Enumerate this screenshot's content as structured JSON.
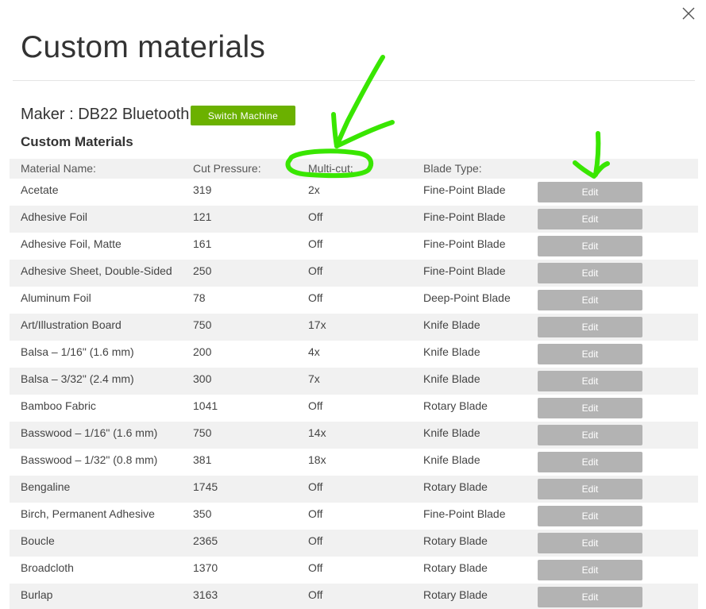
{
  "dialog": {
    "title": "Custom materials",
    "close_icon": "close-icon"
  },
  "machine": {
    "label": "Maker : DB22 Bluetooth",
    "switch_button": "Switch Machine",
    "switch_button_color": "#6bb100"
  },
  "materials": {
    "section_title": "Custom Materials",
    "columns": {
      "name": "Material Name:",
      "pressure": "Cut Pressure:",
      "multicut": "Multi-cut:",
      "blade": "Blade Type:"
    },
    "edit_label": "Edit",
    "edit_button_color": "#b3b3b3",
    "rows": [
      {
        "name": "Acetate",
        "pressure": "319",
        "multicut": "2x",
        "blade": "Fine-Point Blade"
      },
      {
        "name": "Adhesive Foil",
        "pressure": "121",
        "multicut": "Off",
        "blade": "Fine-Point Blade"
      },
      {
        "name": "Adhesive Foil, Matte",
        "pressure": "161",
        "multicut": "Off",
        "blade": "Fine-Point Blade"
      },
      {
        "name": "Adhesive Sheet, Double-Sided",
        "pressure": "250",
        "multicut": "Off",
        "blade": "Fine-Point Blade"
      },
      {
        "name": "Aluminum Foil",
        "pressure": "78",
        "multicut": "Off",
        "blade": "Deep-Point Blade"
      },
      {
        "name": "Art/Illustration Board",
        "pressure": "750",
        "multicut": "17x",
        "blade": "Knife Blade"
      },
      {
        "name": "Balsa – 1/16\" (1.6 mm)",
        "pressure": "200",
        "multicut": "4x",
        "blade": "Knife Blade"
      },
      {
        "name": "Balsa – 3/32\" (2.4 mm)",
        "pressure": "300",
        "multicut": "7x",
        "blade": "Knife Blade"
      },
      {
        "name": "Bamboo Fabric",
        "pressure": "1041",
        "multicut": "Off",
        "blade": "Rotary Blade"
      },
      {
        "name": "Basswood – 1/16\" (1.6 mm)",
        "pressure": "750",
        "multicut": "14x",
        "blade": "Knife Blade"
      },
      {
        "name": "Basswood – 1/32\" (0.8 mm)",
        "pressure": "381",
        "multicut": "18x",
        "blade": "Knife Blade"
      },
      {
        "name": "Bengaline",
        "pressure": "1745",
        "multicut": "Off",
        "blade": "Rotary Blade"
      },
      {
        "name": "Birch, Permanent Adhesive",
        "pressure": "350",
        "multicut": "Off",
        "blade": "Fine-Point Blade"
      },
      {
        "name": "Boucle",
        "pressure": "2365",
        "multicut": "Off",
        "blade": "Rotary Blade"
      },
      {
        "name": "Broadcloth",
        "pressure": "1370",
        "multicut": "Off",
        "blade": "Rotary Blade"
      },
      {
        "name": "Burlap",
        "pressure": "3163",
        "multicut": "Off",
        "blade": "Rotary Blade"
      }
    ]
  },
  "annotation": {
    "ink_color": "#39e600"
  }
}
